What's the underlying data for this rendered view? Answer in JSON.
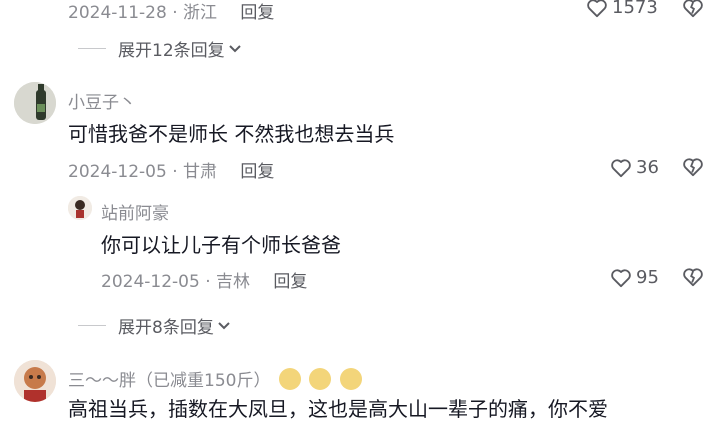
{
  "thread_top": {
    "meta": {
      "date": "2024-11-28",
      "location": "浙江",
      "reply_label": "回复"
    },
    "likes": "1573",
    "expand_label": "展开12条回复"
  },
  "comment1": {
    "username": "小豆子丶",
    "text": "可惜我爸不是师长  不然我也想去当兵",
    "meta": {
      "date": "2024-12-05",
      "location": "甘肃",
      "reply_label": "回复"
    },
    "likes": "36",
    "reply": {
      "username": "站前阿豪",
      "text": "你可以让儿子有个师长爸爸",
      "meta": {
        "date": "2024-12-05",
        "location": "吉林",
        "reply_label": "回复"
      },
      "likes": "95"
    },
    "expand_label": "展开8条回复"
  },
  "comment2": {
    "username": "三～～胖（已减重150斤）",
    "text_partial": "高祖当兵，插数在大凤旦，这也是高大山一辈子的痛，你不爱"
  },
  "icons": [
    "heart-icon",
    "dislike-heart-icon",
    "chevron-down-icon"
  ]
}
